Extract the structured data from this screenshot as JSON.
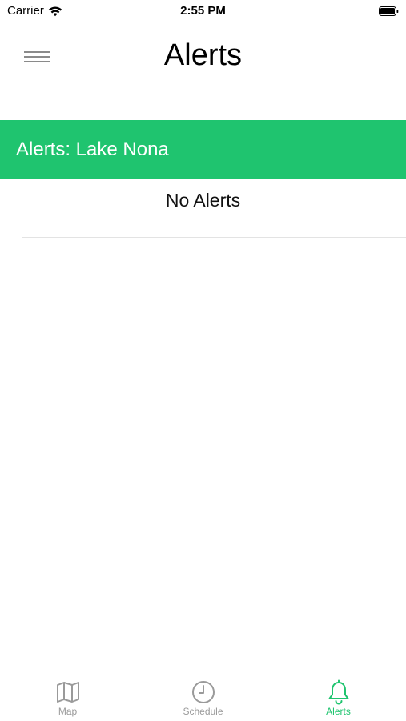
{
  "status_bar": {
    "carrier": "Carrier",
    "time": "2:55 PM"
  },
  "header": {
    "title": "Alerts",
    "menu_icon": "hamburger-menu-icon"
  },
  "section": {
    "title": "Alerts: Lake Nona"
  },
  "content": {
    "empty_message": "No Alerts"
  },
  "tab_bar": {
    "tabs": [
      {
        "label": "Map",
        "icon": "map-icon",
        "active": false
      },
      {
        "label": "Schedule",
        "icon": "clock-icon",
        "active": false
      },
      {
        "label": "Alerts",
        "icon": "bell-icon",
        "active": true
      }
    ]
  },
  "colors": {
    "accent": "#1fc46f",
    "inactive": "#9a9a9a",
    "divider": "#e3e3e3"
  }
}
